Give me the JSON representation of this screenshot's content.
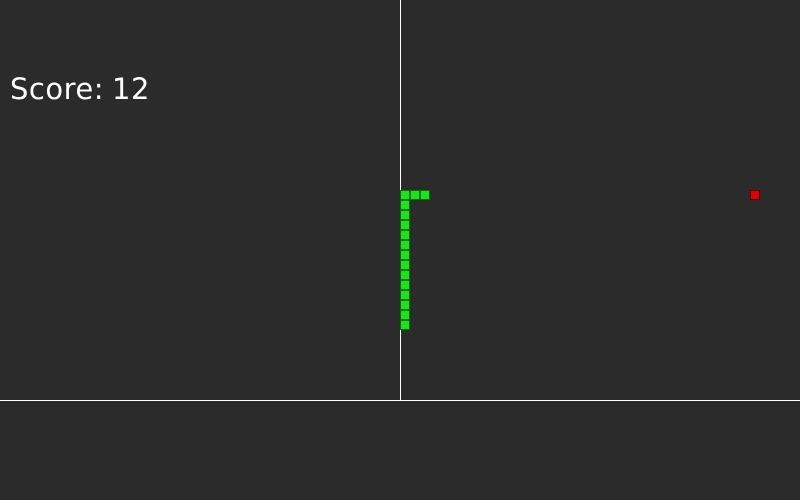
{
  "hud": {
    "score_label": "Score:",
    "score_value": "12"
  },
  "board": {
    "columns": 80,
    "rows": 40
  },
  "snake": {
    "color": "#19e619",
    "cells": [
      [
        42,
        19
      ],
      [
        41,
        19
      ],
      [
        40,
        19
      ],
      [
        40,
        20
      ],
      [
        40,
        21
      ],
      [
        40,
        22
      ],
      [
        40,
        23
      ],
      [
        40,
        24
      ],
      [
        40,
        25
      ],
      [
        40,
        26
      ],
      [
        40,
        27
      ],
      [
        40,
        28
      ],
      [
        40,
        29
      ],
      [
        40,
        30
      ],
      [
        40,
        31
      ],
      [
        40,
        32
      ]
    ]
  },
  "food": {
    "color": "#e00000",
    "cell": [
      75,
      19
    ]
  },
  "colors": {
    "background": "#2b2b2b",
    "grid_line": "#ffffff",
    "text": "#ffffff"
  }
}
